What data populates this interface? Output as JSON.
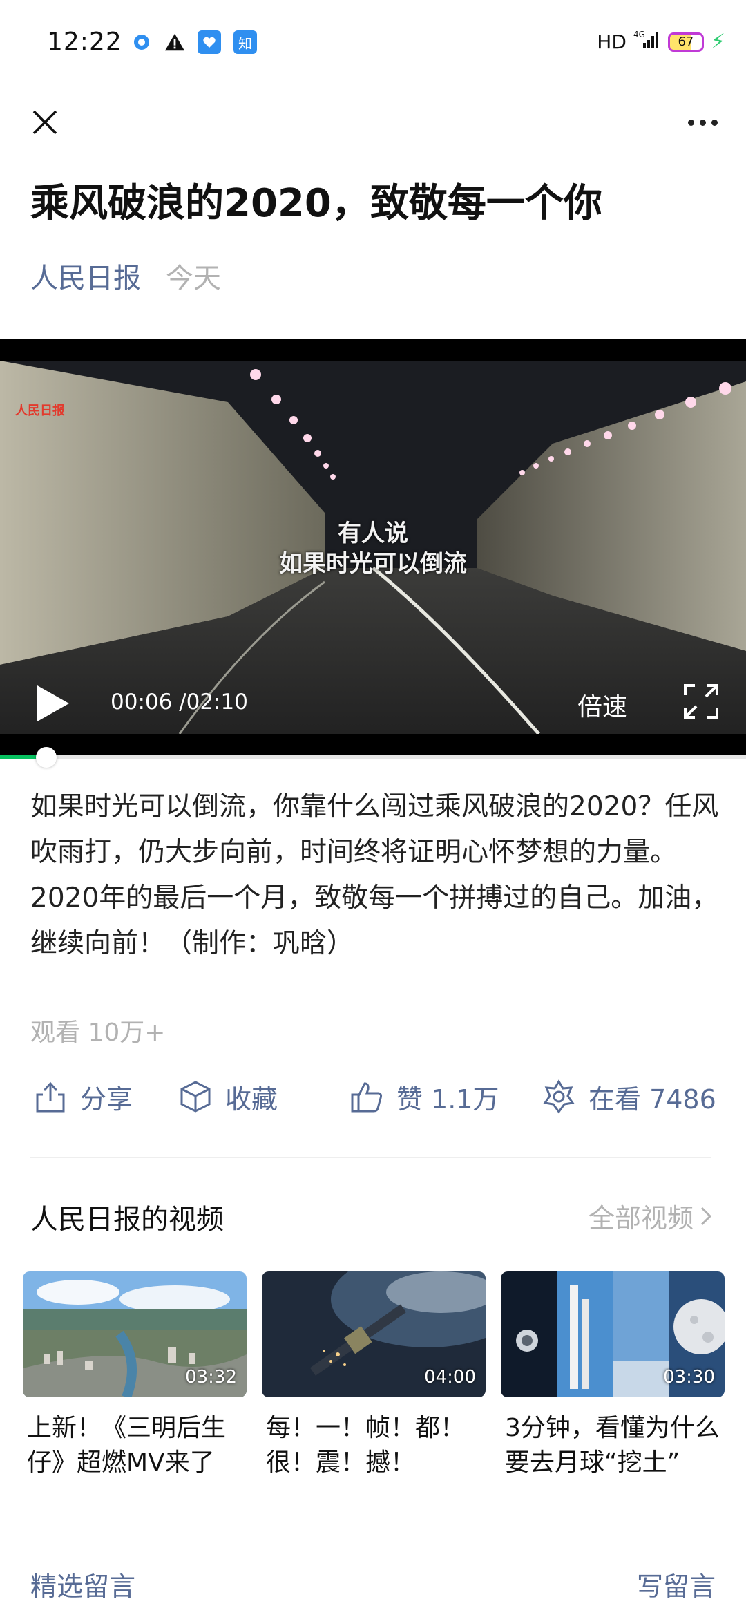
{
  "status_bar": {
    "time": "12:22",
    "network": "HD",
    "signal": "4G",
    "battery": "67",
    "app_icon_text": "知"
  },
  "article": {
    "title": "乘风破浪的2020，致敬每一个你",
    "author": "人民日报",
    "date": "今天",
    "description": "如果时光可以倒流，你靠什么闯过乘风破浪的2020？任风吹雨打，仍大步向前，时间终将证明心怀梦想的力量。2020年的最后一个月，致敬每一个拼搏过的自己。加油，继续向前！（制作：巩晗）",
    "views": "观看 10万+"
  },
  "video": {
    "subtitle_line1": "有人说",
    "subtitle_line2": "如果时光可以倒流",
    "current_time": "00:06",
    "duration": "/02:10",
    "speed_label": "倍速",
    "progress": 0.05,
    "watermark": "人民日报"
  },
  "actions": {
    "share": "分享",
    "favorite": "收藏",
    "like": "赞 1.1万",
    "watching": "在看 7486"
  },
  "related": {
    "section_title": "人民日报的视频",
    "see_all": "全部视频",
    "videos": [
      {
        "title": "上新！《三明后生仔》超燃MV来了",
        "duration": "03:32"
      },
      {
        "title": "每！一！帧！都！很！震！撼！",
        "duration": "04:00"
      },
      {
        "title": "3分钟，看懂为什么要去月球“挖土”",
        "duration": "03:30"
      }
    ]
  },
  "comments": {
    "label": "精选留言",
    "write": "写留言"
  },
  "colors": {
    "link": "#576b95",
    "accent": "#07c160",
    "muted": "#b2b2b2"
  }
}
